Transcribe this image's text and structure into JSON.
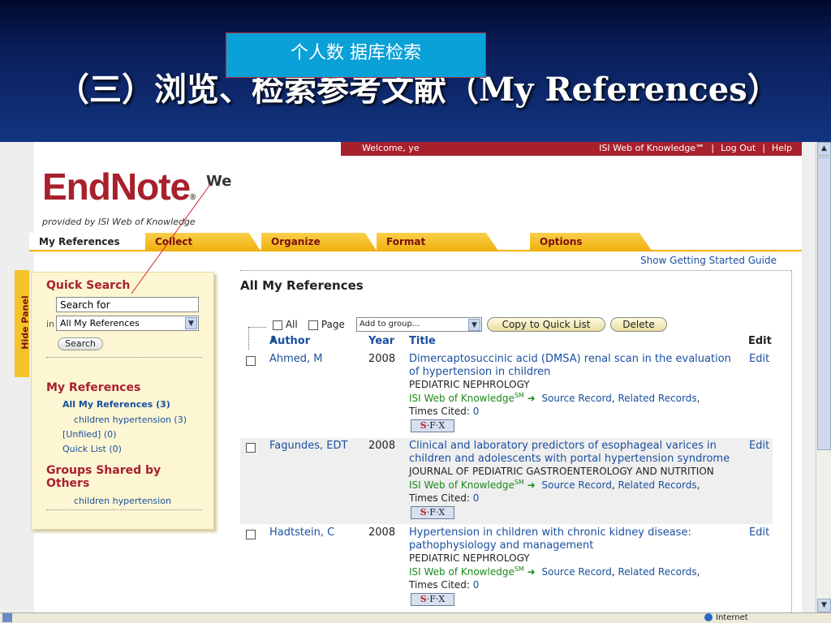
{
  "slide": {
    "title": "（三）浏览、检索参考文献（My References）",
    "callout": "个人数  据库检索"
  },
  "header": {
    "welcome": "Welcome, ye",
    "isi_link": "ISI Web of Knowledge℠",
    "sep": "|",
    "logout": "Log Out",
    "help": "Help"
  },
  "logo": {
    "main": "EndNote",
    "reg": "®",
    "sub": "provided by ISI Web of Knowledge",
    "web_partial": "We"
  },
  "tabs": [
    "My References",
    "Collect",
    "Organize",
    "Format",
    "Options"
  ],
  "getting_started": "Show Getting Started Guide",
  "hide_panel": "Hide Panel",
  "quick_search": {
    "heading": "Quick Search",
    "input_value": "Search for",
    "in_label": "in",
    "select_value": "All My References",
    "button": "Search"
  },
  "my_refs": {
    "heading": "My References",
    "all": "All My References (3)",
    "group": "children hypertension (3)",
    "unfiled": "[Unfiled] (0)",
    "quick_list": "Quick List (0)"
  },
  "shared": {
    "heading_line1": "Groups Shared by",
    "heading_line2": "Others",
    "item": "children hypertension"
  },
  "main": {
    "title": "All My References",
    "all_label": "All",
    "page_label": "Page",
    "group_select": "Add to group...",
    "copy_button": "Copy to Quick List",
    "delete_button": "Delete",
    "columns": {
      "author": "Author",
      "year": "Year",
      "title": "Title",
      "edit": "Edit"
    },
    "sort_arrow": "⬆"
  },
  "records": [
    {
      "author": "Ahmed, M",
      "year": "2008",
      "title": "Dimercaptosuccinic acid (DMSA) renal scan in the evaluation of hypertension in children",
      "journal": "PEDIATRIC NEPHROLOGY",
      "isi": "ISI Web of Knowledge",
      "sm": "SM",
      "arrow": "➜",
      "source": "Source Record",
      "related": "Related Records",
      "cited_label": "Times Cited:",
      "cited": "0",
      "edit": "Edit"
    },
    {
      "author": "Fagundes, EDT",
      "year": "2008",
      "title": "Clinical and laboratory predictors of esophageal varices in children and adolescents with portal hypertension syndrome",
      "journal": "JOURNAL OF PEDIATRIC GASTROENTEROLOGY AND NUTRITION",
      "isi": "ISI Web of Knowledge",
      "sm": "SM",
      "arrow": "➜",
      "source": "Source Record",
      "related": "Related Records",
      "cited_label": "Times Cited:",
      "cited": "0",
      "edit": "Edit"
    },
    {
      "author": "Hadtstein, C",
      "year": "2008",
      "title": "Hypertension in children with chronic kidney disease: pathophysiology and management",
      "journal": "PEDIATRIC NEPHROLOGY",
      "isi": "ISI Web of Knowledge",
      "sm": "SM",
      "arrow": "➜",
      "source": "Source Record",
      "related": "Related Records",
      "cited_label": "Times Cited:",
      "cited": "0",
      "edit": "Edit"
    }
  ],
  "sfx": {
    "s": "S",
    "rest": "·F·X"
  },
  "status": {
    "zone": "Internet"
  },
  "colors": {
    "brand_red": "#a8202c",
    "link_blue": "#1a4fa0",
    "tab_yellow": "#f0b010",
    "isi_green": "#1a8a1a"
  }
}
